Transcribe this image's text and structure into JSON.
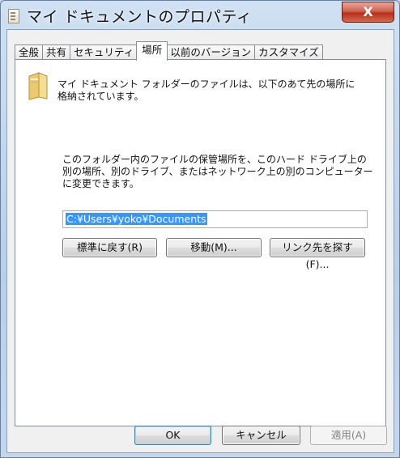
{
  "window": {
    "title": "マイ ドキュメントのプロパティ",
    "close_label": "X"
  },
  "tabs": [
    {
      "label": "全般"
    },
    {
      "label": "共有"
    },
    {
      "label": "セキュリティ"
    },
    {
      "label": "場所"
    },
    {
      "label": "以前のバージョン"
    },
    {
      "label": "カスタマイズ"
    }
  ],
  "active_tab": "場所",
  "location": {
    "description_line1": "マイ ドキュメント フォルダーのファイルは、以下のあて先の場所に",
    "description_line2": "格納されています。",
    "move_line1": "このフォルダー内のファイルの保管場所を、このハード ドライブ上の",
    "move_line2": "別の場所、別のドライブ、またはネットワーク上の別のコンピューター",
    "move_line3": "に変更できます。",
    "path_value": "C:¥Users¥yoko¥Documents",
    "restore_default_button": "標準に戻す(R)",
    "move_button": "移動(M)...",
    "find_target_button": "リンク先を探す(F)..."
  },
  "footer": {
    "ok_button": "OK",
    "cancel_button": "キャンセル",
    "apply_button": "適用(A)"
  },
  "colors": {
    "selection": "#3399ff",
    "close": "#c84a35"
  }
}
